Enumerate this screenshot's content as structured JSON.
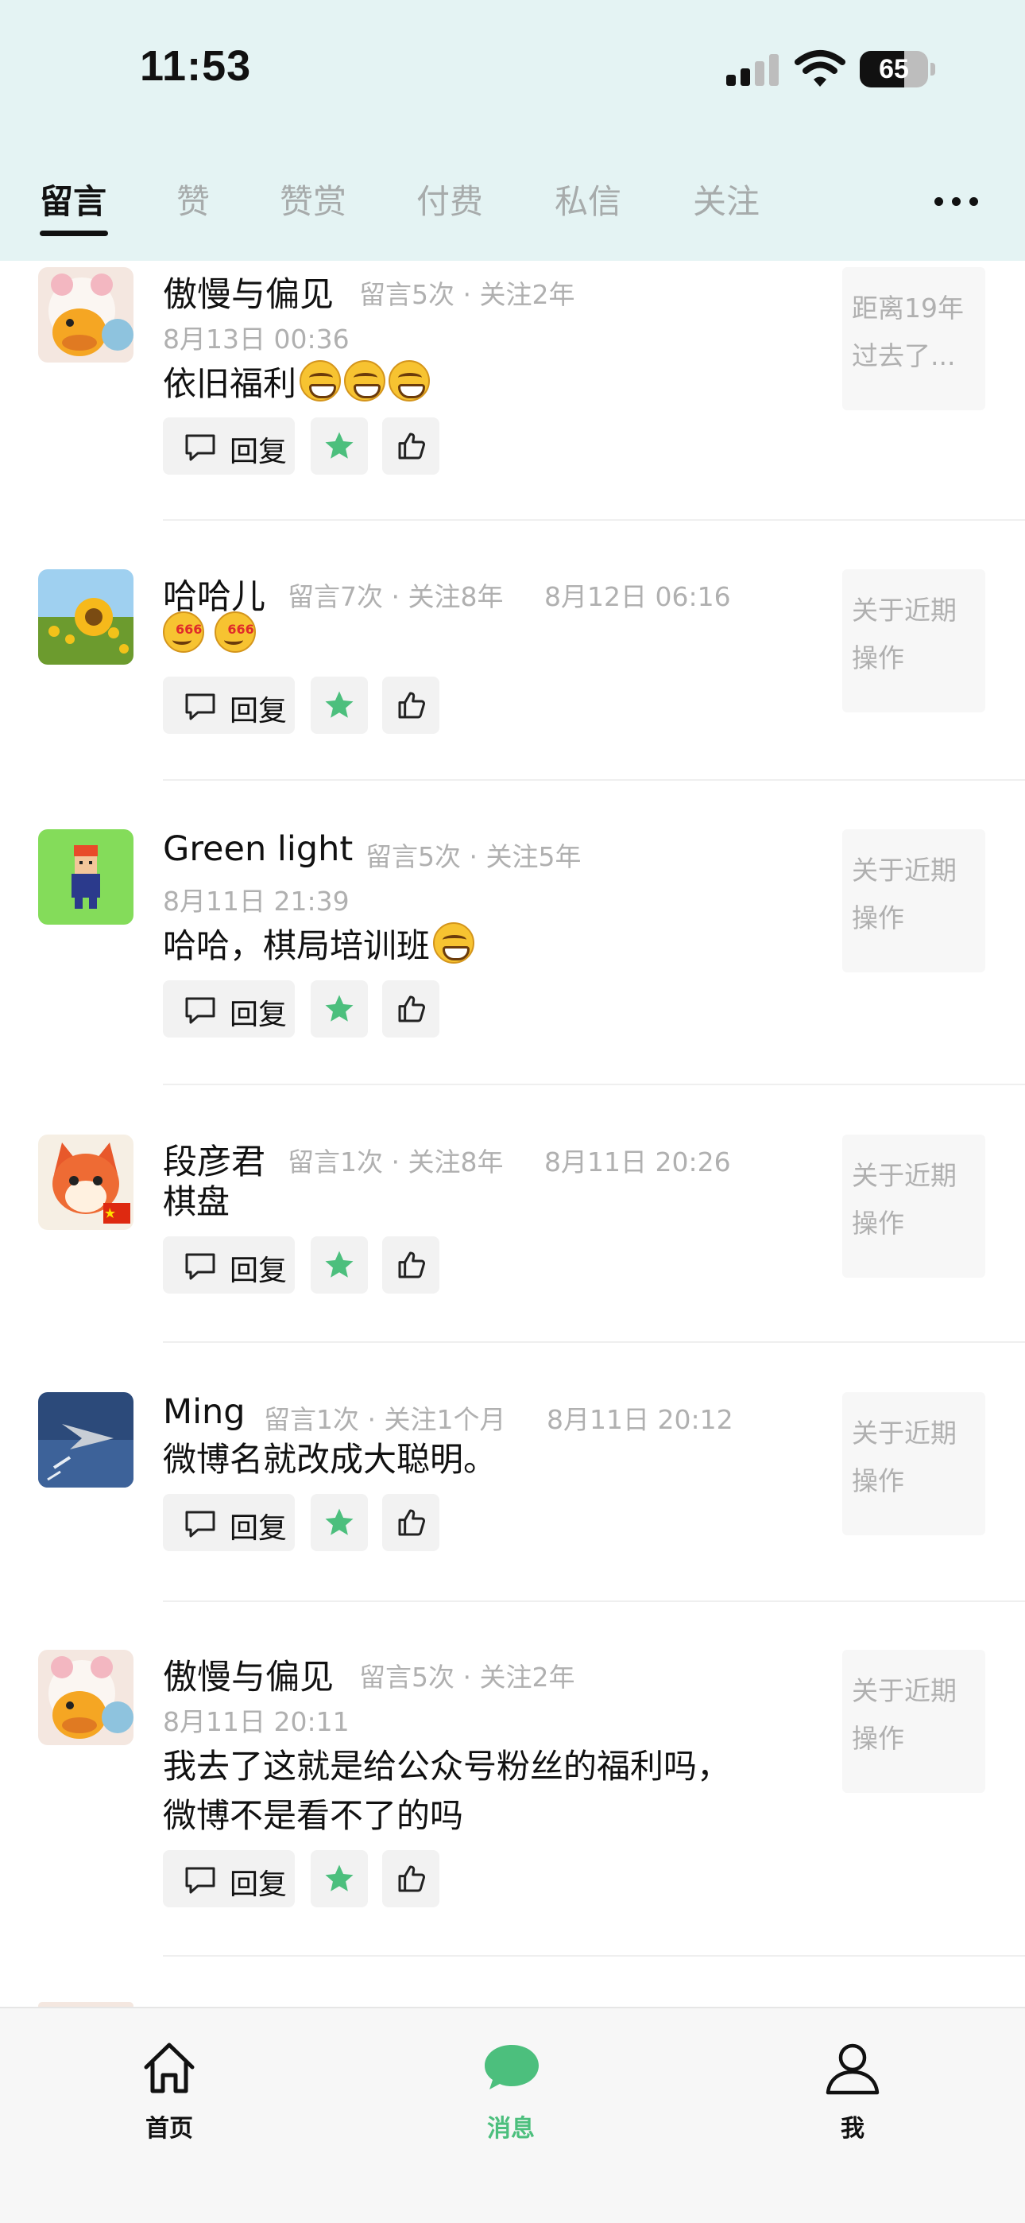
{
  "status_bar": {
    "time": "11:53",
    "battery": "65",
    "battery_level": 0.65
  },
  "tabs": [
    {
      "label": "留言",
      "active": true
    },
    {
      "label": "赞",
      "active": false
    },
    {
      "label": "赞赏",
      "active": false
    },
    {
      "label": "付费",
      "active": false
    },
    {
      "label": "私信",
      "active": false
    },
    {
      "label": "关注",
      "active": false
    }
  ],
  "more_icon": "more-dots-icon",
  "comments": [
    {
      "name": "傲慢与偏见",
      "meta": "留言5次 · 关注2年",
      "date": "8月13日 00:36",
      "text": "依旧福利",
      "emojis": "grin x3",
      "reply_label": "回复",
      "side": "距离19年过去了..."
    },
    {
      "name": "哈哈儿",
      "meta": "留言7次 · 关注8年",
      "date": "8月12日 06:16",
      "text": "",
      "emojis": "666 x2",
      "reply_label": "回复",
      "side": "关于近期操作"
    },
    {
      "name": "Green light",
      "meta": "留言5次 · 关注5年",
      "date": "8月11日 21:39",
      "text": "哈哈，棋局培训班",
      "emojis": "grin x1",
      "reply_label": "回复",
      "side": "关于近期操作"
    },
    {
      "name": "段彦君",
      "meta": "留言1次 · 关注8年",
      "date": "8月11日 20:26",
      "text": "棋盘",
      "reply_label": "回复",
      "side": "关于近期操作"
    },
    {
      "name": "Ming",
      "meta": "留言1次 · 关注1个月",
      "date": "8月11日 20:12",
      "text": "微博名就改成大聪明。",
      "reply_label": "回复",
      "side": "关于近期操作"
    },
    {
      "name": "傲慢与偏见",
      "meta": "留言5次 · 关注2年",
      "date": "8月11日 20:11",
      "text_line1": "我去了这就是给公众号粉丝的福利吗，",
      "text_line2": "微博不是看不了的吗",
      "reply_label": "回复",
      "side": "关于近期操作"
    }
  ],
  "bottom_nav": [
    {
      "label": "首页",
      "icon": "home-icon",
      "active": false
    },
    {
      "label": "消息",
      "icon": "message-bubble-icon",
      "active": true
    },
    {
      "label": "我",
      "icon": "person-icon",
      "active": false
    }
  ],
  "colors": {
    "header_bg": "#e4f3f3",
    "accent_green": "#4cbf7d",
    "muted_text": "#b0b0b0"
  }
}
